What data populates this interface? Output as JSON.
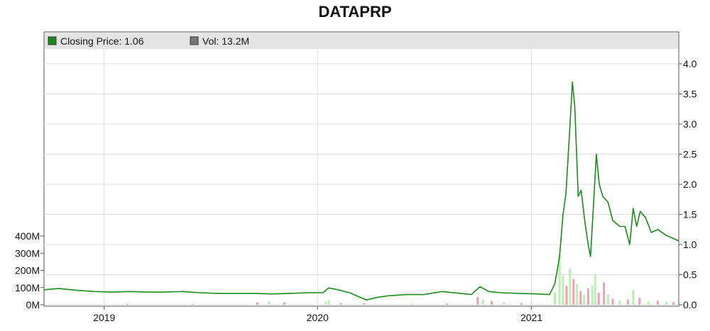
{
  "chart_data": {
    "type": "line",
    "title": "DATAPRP",
    "legend": {
      "placement": "top-left",
      "items": [
        {
          "label": "Closing Price: 1.06",
          "color": "#1a8c1a"
        },
        {
          "label": "Vol: 13.2M",
          "color": "#777777"
        }
      ]
    },
    "grid": true,
    "x_ticks": [
      {
        "label": "2019",
        "date": "2019-01-01"
      },
      {
        "label": "2020",
        "date": "2020-01-01"
      },
      {
        "label": "2021",
        "date": "2021-01-01"
      }
    ],
    "x_range": [
      "2018-09-20",
      "2021-09-10"
    ],
    "price_axis": {
      "position": "right",
      "ylim": [
        0,
        4.5
      ],
      "ticks": [
        "0.0",
        "0.5",
        "1.0",
        "1.5",
        "2.0",
        "2.5",
        "3.0",
        "3.5",
        "4.0"
      ]
    },
    "volume_axis": {
      "position": "left",
      "ylim": [
        0,
        400
      ],
      "unit": "M",
      "ticks": [
        "0M",
        "100M",
        "200M",
        "300M",
        "400M"
      ]
    },
    "series": [
      {
        "name": "Closing Price",
        "color": "#1a8c1a",
        "points": [
          [
            "2018-09-20",
            0.25
          ],
          [
            "2018-10-15",
            0.27
          ],
          [
            "2018-11-15",
            0.24
          ],
          [
            "2018-12-15",
            0.22
          ],
          [
            "2019-01-15",
            0.21
          ],
          [
            "2019-02-15",
            0.22
          ],
          [
            "2019-03-15",
            0.21
          ],
          [
            "2019-04-15",
            0.21
          ],
          [
            "2019-05-15",
            0.22
          ],
          [
            "2019-06-15",
            0.2
          ],
          [
            "2019-07-15",
            0.19
          ],
          [
            "2019-08-15",
            0.19
          ],
          [
            "2019-09-15",
            0.19
          ],
          [
            "2019-10-15",
            0.18
          ],
          [
            "2019-11-15",
            0.19
          ],
          [
            "2019-12-15",
            0.2
          ],
          [
            "2020-01-10",
            0.2
          ],
          [
            "2020-01-20",
            0.28
          ],
          [
            "2020-02-05",
            0.25
          ],
          [
            "2020-02-25",
            0.2
          ],
          [
            "2020-03-10",
            0.14
          ],
          [
            "2020-03-25",
            0.08
          ],
          [
            "2020-04-10",
            0.12
          ],
          [
            "2020-05-01",
            0.15
          ],
          [
            "2020-06-01",
            0.17
          ],
          [
            "2020-07-01",
            0.17
          ],
          [
            "2020-08-01",
            0.22
          ],
          [
            "2020-09-01",
            0.19
          ],
          [
            "2020-09-20",
            0.17
          ],
          [
            "2020-10-05",
            0.3
          ],
          [
            "2020-10-20",
            0.22
          ],
          [
            "2020-11-10",
            0.2
          ],
          [
            "2020-12-10",
            0.19
          ],
          [
            "2021-01-10",
            0.18
          ],
          [
            "2021-02-01",
            0.17
          ],
          [
            "2021-02-10",
            0.35
          ],
          [
            "2021-02-18",
            0.8
          ],
          [
            "2021-02-24",
            1.5
          ],
          [
            "2021-03-01",
            1.85
          ],
          [
            "2021-03-08",
            3.0
          ],
          [
            "2021-03-12",
            3.7
          ],
          [
            "2021-03-16",
            3.3
          ],
          [
            "2021-03-22",
            1.8
          ],
          [
            "2021-03-27",
            1.9
          ],
          [
            "2021-04-02",
            1.4
          ],
          [
            "2021-04-08",
            1.0
          ],
          [
            "2021-04-12",
            0.8
          ],
          [
            "2021-04-18",
            1.8
          ],
          [
            "2021-04-22",
            2.5
          ],
          [
            "2021-04-27",
            2.0
          ],
          [
            "2021-05-03",
            1.8
          ],
          [
            "2021-05-12",
            1.7
          ],
          [
            "2021-05-20",
            1.4
          ],
          [
            "2021-06-01",
            1.3
          ],
          [
            "2021-06-10",
            1.3
          ],
          [
            "2021-06-18",
            1.0
          ],
          [
            "2021-06-24",
            1.6
          ],
          [
            "2021-06-30",
            1.3
          ],
          [
            "2021-07-06",
            1.55
          ],
          [
            "2021-07-15",
            1.45
          ],
          [
            "2021-07-25",
            1.2
          ],
          [
            "2021-08-05",
            1.25
          ],
          [
            "2021-08-20",
            1.15
          ],
          [
            "2021-09-01",
            1.1
          ],
          [
            "2021-09-10",
            1.06
          ]
        ]
      },
      {
        "name": "Vol",
        "bars": [
          [
            "2018-09-20",
            8,
            "#b8b8b8"
          ],
          [
            "2019-02-10",
            6,
            "#b8b8b8"
          ],
          [
            "2019-06-01",
            5,
            "#b8b8b8"
          ],
          [
            "2019-09-20",
            12,
            "#d9a0a0"
          ],
          [
            "2019-10-10",
            22,
            "#c0e8c0"
          ],
          [
            "2019-11-05",
            14,
            "#e8a0a8"
          ],
          [
            "2020-01-15",
            18,
            "#c0e8c0"
          ],
          [
            "2020-01-20",
            26,
            "#c0e8c0"
          ],
          [
            "2020-02-10",
            10,
            "#e8a0a8"
          ],
          [
            "2020-03-20",
            9,
            "#e8a0a8"
          ],
          [
            "2020-06-10",
            8,
            "#c0e8c0"
          ],
          [
            "2020-08-10",
            7,
            "#e8a0a8"
          ],
          [
            "2020-10-01",
            45,
            "#e8a0a8"
          ],
          [
            "2020-10-10",
            30,
            "#c0e8c0"
          ],
          [
            "2020-10-25",
            22,
            "#e8a0a8"
          ],
          [
            "2020-11-15",
            14,
            "#c0e8c0"
          ],
          [
            "2020-12-15",
            10,
            "#e8a0a8"
          ],
          [
            "2021-02-10",
            70,
            "#b8f0b0"
          ],
          [
            "2021-02-18",
            290,
            "#b8f0b0"
          ],
          [
            "2021-02-24",
            170,
            "#b8f0b0"
          ],
          [
            "2021-03-02",
            110,
            "#f0a0b0"
          ],
          [
            "2021-03-08",
            210,
            "#b8f0b0"
          ],
          [
            "2021-03-14",
            150,
            "#f0a0b0"
          ],
          [
            "2021-03-20",
            120,
            "#b8f0b0"
          ],
          [
            "2021-03-26",
            80,
            "#f0a0b0"
          ],
          [
            "2021-04-01",
            60,
            "#b8f0b0"
          ],
          [
            "2021-04-08",
            95,
            "#f0a0b0"
          ],
          [
            "2021-04-15",
            110,
            "#b8f0b0"
          ],
          [
            "2021-04-20",
            175,
            "#b8f0b0"
          ],
          [
            "2021-04-26",
            70,
            "#f0a0b0"
          ],
          [
            "2021-05-05",
            130,
            "#f0a0b0"
          ],
          [
            "2021-05-12",
            60,
            "#b8f0b0"
          ],
          [
            "2021-05-20",
            35,
            "#f0a0b0"
          ],
          [
            "2021-06-01",
            25,
            "#b8f0b0"
          ],
          [
            "2021-06-15",
            30,
            "#f0a0b0"
          ],
          [
            "2021-06-24",
            85,
            "#b8f0b0"
          ],
          [
            "2021-07-05",
            40,
            "#f0a0b0"
          ],
          [
            "2021-07-20",
            20,
            "#b8f0b0"
          ],
          [
            "2021-08-05",
            25,
            "#f0a0b0"
          ],
          [
            "2021-08-20",
            18,
            "#b8f0b0"
          ],
          [
            "2021-09-01",
            15,
            "#f0a0b0"
          ]
        ]
      }
    ]
  }
}
